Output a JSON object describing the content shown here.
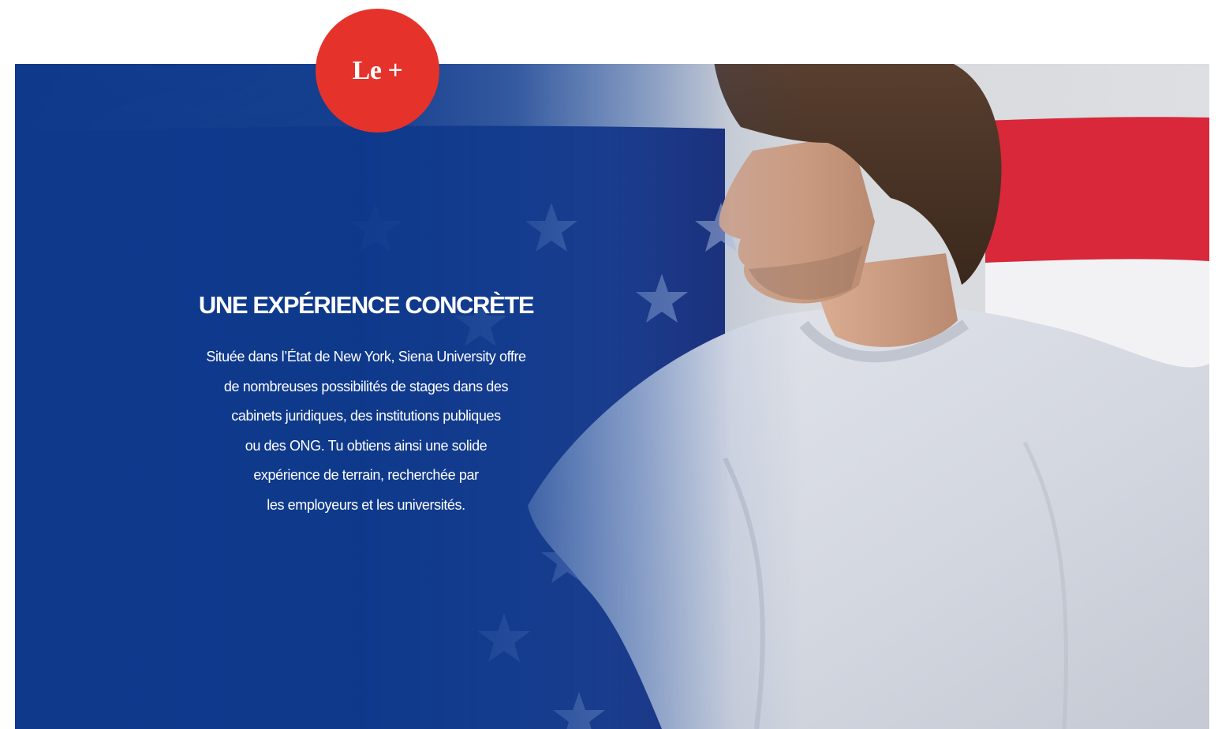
{
  "badge": {
    "label": "Le +"
  },
  "section": {
    "title": "UNE EXPÉRIENCE CONCRÈTE",
    "body_lines": [
      "Située dans l’État de New York, Siena University offre",
      "de nombreuses possibilités de stages dans des",
      "cabinets juridiques, des institutions publiques",
      "ou des ONG. Tu obtiens ainsi une solide",
      "expérience de terrain, recherchée par",
      "les employeurs et les universités."
    ]
  },
  "colors": {
    "overlay_blue": "#0f3a8c",
    "badge_red": "#e5322b",
    "flag_red": "#d8283a",
    "text_white": "#ffffff"
  }
}
